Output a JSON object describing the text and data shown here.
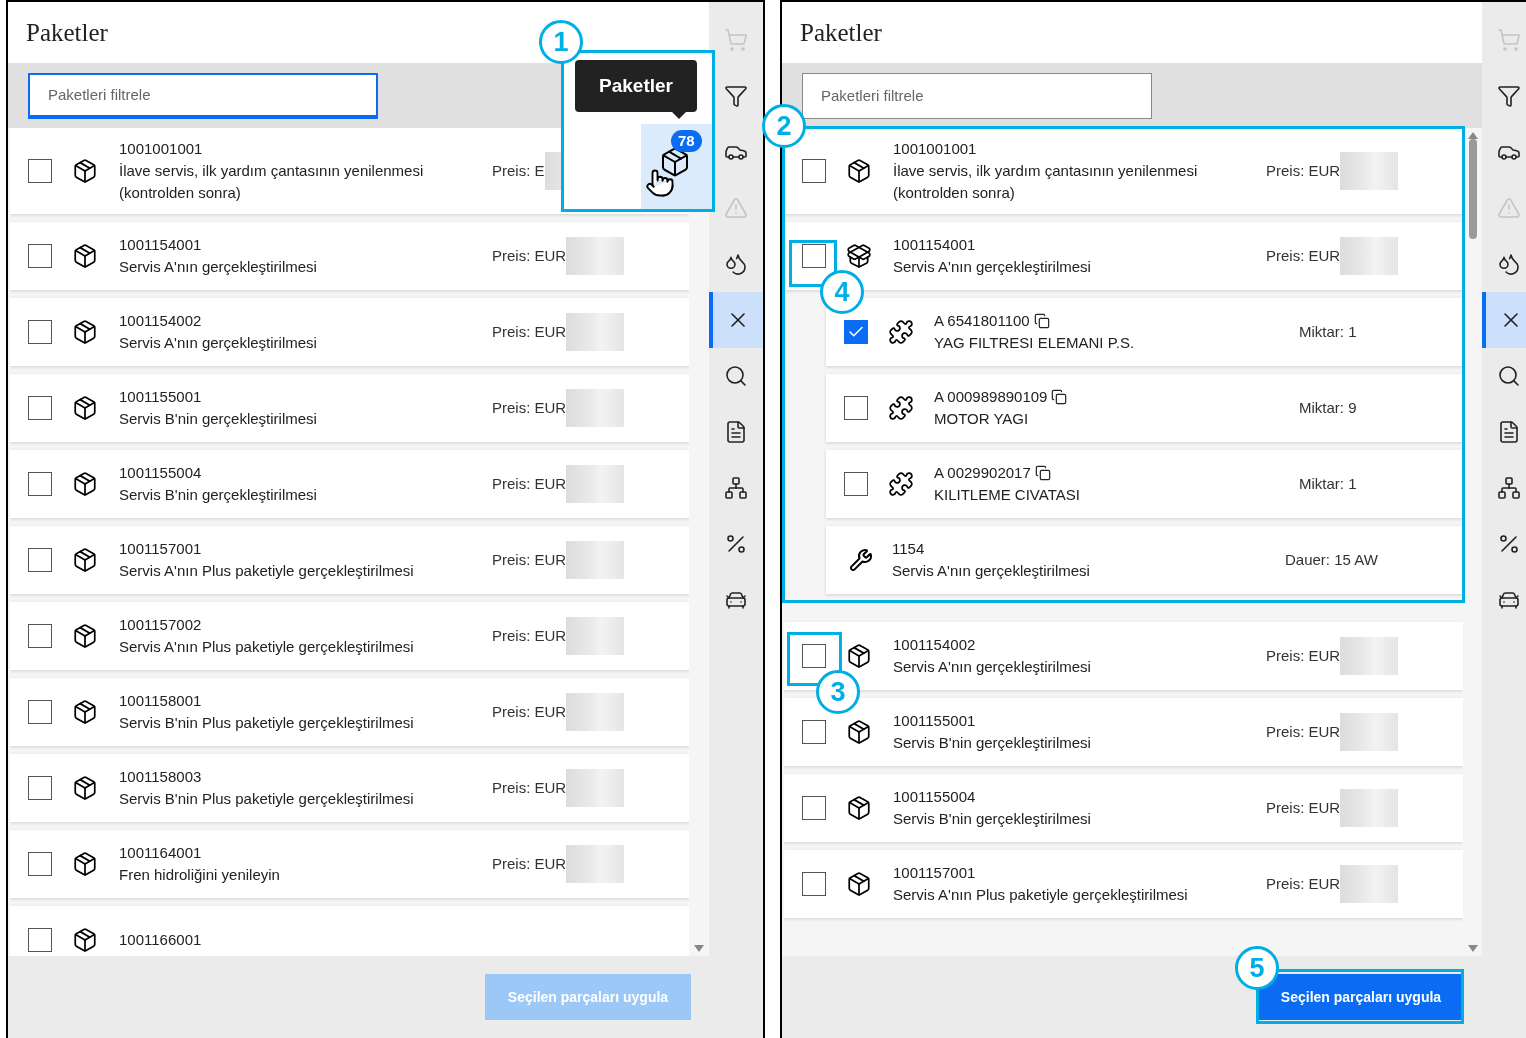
{
  "panels": [
    {
      "title": "Paketler",
      "filter": {
        "placeholder": "Paketleri filtrele",
        "focused": true
      },
      "rows": [
        {
          "kind": "package",
          "number": "1001001001",
          "description": "İlave servis, ilk yardım çantasının yenilenmesi (kontrolden sonra)",
          "price": "Preis: E",
          "checked": false,
          "expanded": false
        },
        {
          "kind": "package",
          "number": "1001154001",
          "description": "Servis A'nın gerçekleştirilmesi",
          "price": "Preis: EUR",
          "checked": false,
          "expanded": false
        },
        {
          "kind": "package",
          "number": "1001154002",
          "description": "Servis A'nın gerçekleştirilmesi",
          "price": "Preis: EUR",
          "checked": false,
          "expanded": false
        },
        {
          "kind": "package",
          "number": "1001155001",
          "description": "Servis B'nin gerçekleştirilmesi",
          "price": "Preis: EUR",
          "checked": false,
          "expanded": false
        },
        {
          "kind": "package",
          "number": "1001155004",
          "description": "Servis B'nin gerçekleştirilmesi",
          "price": "Preis: EUR",
          "checked": false,
          "expanded": false
        },
        {
          "kind": "package",
          "number": "1001157001",
          "description": "Servis A'nın Plus paketiyle gerçekleştirilmesi",
          "price": "Preis: EUR",
          "checked": false,
          "expanded": false
        },
        {
          "kind": "package",
          "number": "1001157002",
          "description": "Servis A'nın Plus paketiyle gerçekleştirilmesi",
          "price": "Preis: EUR",
          "checked": false,
          "expanded": false
        },
        {
          "kind": "package",
          "number": "1001158001",
          "description": "Servis B'nin Plus paketiyle gerçekleştirilmesi",
          "price": "Preis: EUR",
          "checked": false,
          "expanded": false
        },
        {
          "kind": "package",
          "number": "1001158003",
          "description": "Servis B'nin Plus paketiyle gerçekleştirilmesi",
          "price": "Preis: EUR",
          "checked": false,
          "expanded": false
        },
        {
          "kind": "package",
          "number": "1001164001",
          "description": "Fren hidroliğini yenileyin",
          "price": "Preis: EUR",
          "checked": false,
          "expanded": false
        },
        {
          "kind": "package",
          "number": "1001166001",
          "checked": false,
          "expanded": false
        }
      ],
      "apply_button": {
        "label": "Seçilen parçaları uygula",
        "disabled": true
      },
      "sidebar": [
        {
          "disabled": true,
          "selected": false
        },
        {
          "disabled": false,
          "selected": false
        },
        {
          "disabled": false,
          "selected": false
        },
        {
          "disabled": true,
          "selected": false
        },
        {
          "disabled": false,
          "selected": false
        },
        {
          "disabled": false,
          "selected": true
        },
        {
          "disabled": false,
          "selected": false
        },
        {
          "disabled": false,
          "selected": false
        },
        {
          "disabled": false,
          "selected": false
        },
        {
          "disabled": false,
          "selected": false
        },
        {
          "disabled": false,
          "selected": false
        }
      ],
      "tooltip_overlay": {
        "tooltip": "Paketler",
        "badge": "78"
      }
    },
    {
      "title": "Paketler",
      "filter": {
        "placeholder": "Paketleri filtrele",
        "focused": false
      },
      "rows": [
        {
          "kind": "package",
          "number": "1001001001",
          "description": "İlave servis, ilk yardım çantasının yenilenmesi (kontrolden sonra)",
          "price": "Preis: EUR",
          "checked": false,
          "expanded": false
        },
        {
          "kind": "package",
          "number": "1001154001",
          "description": "Servis A'nın gerçekleştirilmesi",
          "price": "Preis: EUR",
          "checked": false,
          "expanded": true,
          "children": [
            {
              "kind": "part",
              "number": "A 6541801100",
              "description": "YAG FILTRESI ELEMANI P.S.",
              "quantity": "Miktar: 1",
              "checked": true
            },
            {
              "kind": "part",
              "number": "A 000989890109",
              "description": "MOTOR YAGI",
              "quantity": "Miktar: 9",
              "checked": false
            },
            {
              "kind": "part",
              "number": "A 0029902017",
              "description": "KILITLEME CIVATASI",
              "quantity": "Miktar: 1",
              "checked": false
            },
            {
              "kind": "labor",
              "number": "1154",
              "description": "Servis A'nın gerçekleştirilmesi",
              "duration": "Dauer: 15 AW"
            }
          ]
        },
        {
          "kind": "package",
          "number": "1001154002",
          "description": "Servis A'nın gerçekleştirilmesi",
          "price": "Preis: EUR",
          "checked": false,
          "expanded": false
        },
        {
          "kind": "package",
          "number": "1001155001",
          "description": "Servis B'nin gerçekleştirilmesi",
          "price": "Preis: EUR",
          "checked": false,
          "expanded": false
        },
        {
          "kind": "package",
          "number": "1001155004",
          "description": "Servis B'nin gerçekleştirilmesi",
          "price": "Preis: EUR",
          "checked": false,
          "expanded": false
        },
        {
          "kind": "package",
          "number": "1001157001",
          "description": "Servis A'nın Plus paketiyle gerçekleştirilmesi",
          "price": "Preis: EUR",
          "checked": false,
          "expanded": false
        }
      ],
      "apply_button": {
        "label": "Seçilen parçaları uygula",
        "disabled": false
      },
      "sidebar": [
        {
          "disabled": true,
          "selected": false
        },
        {
          "disabled": false,
          "selected": false
        },
        {
          "disabled": false,
          "selected": false
        },
        {
          "disabled": true,
          "selected": false
        },
        {
          "disabled": false,
          "selected": false
        },
        {
          "disabled": false,
          "selected": true
        },
        {
          "disabled": false,
          "selected": false
        },
        {
          "disabled": false,
          "selected": false
        },
        {
          "disabled": false,
          "selected": false
        },
        {
          "disabled": false,
          "selected": false
        },
        {
          "disabled": false,
          "selected": false
        }
      ]
    }
  ],
  "callouts": [
    {
      "number": "1"
    },
    {
      "number": "2"
    },
    {
      "number": "3"
    },
    {
      "number": "4"
    },
    {
      "number": "5"
    }
  ]
}
